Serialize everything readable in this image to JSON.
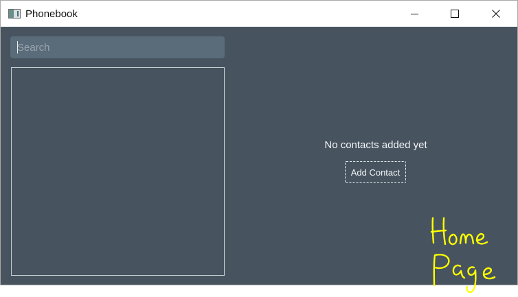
{
  "window": {
    "title": "Phonebook",
    "controls": {
      "minimize": "minimize-icon",
      "maximize": "maximize-icon",
      "close": "close-icon"
    }
  },
  "sidebar": {
    "search": {
      "placeholder": "Search",
      "value": ""
    },
    "contacts": []
  },
  "main": {
    "empty_message": "No contacts added yet",
    "add_contact_label": "Add Contact"
  },
  "annotation": {
    "line1": "Home",
    "line2": "Page",
    "color": "#ffff00"
  },
  "colors": {
    "background": "#47545f",
    "search_background": "#5a6b79",
    "titlebar": "#ffffff"
  }
}
